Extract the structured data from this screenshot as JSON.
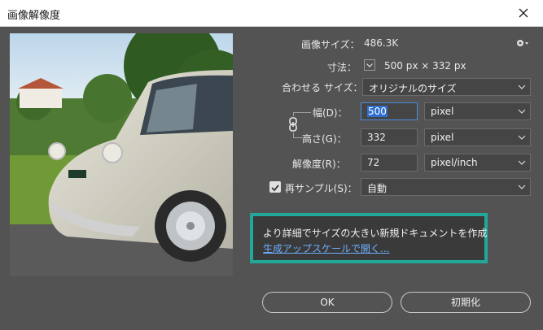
{
  "window": {
    "title": "画像解像度"
  },
  "info": {
    "image_size_label": "画像サイズ：",
    "image_size_value": "486.3K",
    "dimensions_label": "寸法：",
    "dimensions_value": "500 px × 332 px"
  },
  "fit": {
    "label": "合わせる サイズ：",
    "value": "オリジナルのサイズ"
  },
  "width": {
    "label": "幅(D)：",
    "value": "500",
    "unit": "pixel"
  },
  "height": {
    "label": "高さ(G)：",
    "value": "332",
    "unit": "pixel"
  },
  "resolution": {
    "label": "解像度(R)：",
    "value": "72",
    "unit": "pixel/inch"
  },
  "resample": {
    "label": "再サンプル(S)：",
    "checked": true,
    "value": "自動"
  },
  "callout": {
    "line1": "より詳細でサイズの大きい新規ドキュメントを作成",
    "line2": "生成アップスケールで開く..."
  },
  "buttons": {
    "ok": "OK",
    "reset": "初期化"
  },
  "icons": {
    "close": "close-icon",
    "gear": "gear-icon",
    "chevron": "chevron-down-icon",
    "link": "link-chain-icon",
    "check": "check-icon"
  },
  "colors": {
    "accent": "#21a89a",
    "link": "#6eb0ff",
    "focus": "#4a8fe0"
  }
}
